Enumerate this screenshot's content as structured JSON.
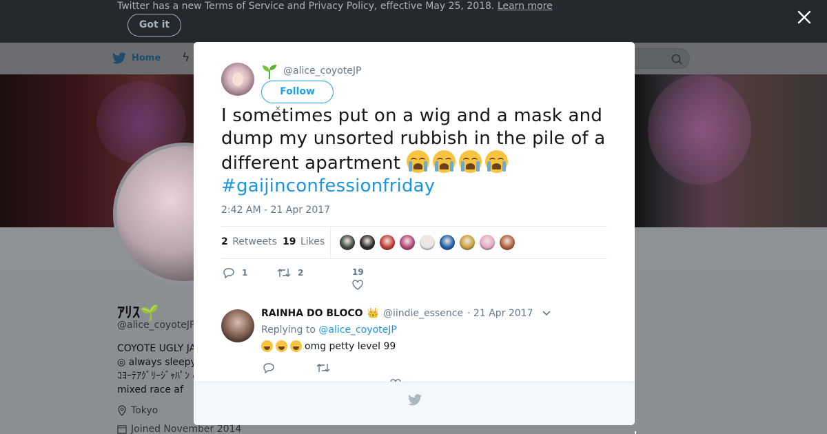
{
  "tos_banner": {
    "text": "Twitter has a new Terms of Service and Privacy Policy, effective May 25, 2018.",
    "link": "Learn more",
    "button": "Got it"
  },
  "nav": {
    "home": "Home",
    "icons": [
      "twitter-bird-icon",
      "bolt-icon",
      "search-icon"
    ]
  },
  "profile": {
    "name": "ｱﾘｽ🌱",
    "handle": "@alice_coyoteJP",
    "bio_lines": [
      "COYOTE UGLY JA",
      "◎ always sleepy",
      "ｺﾖｰﾃｱｸﾞﾘｰｼﾞｬﾊﾟﾝ ◎",
      "mixed race af"
    ],
    "location": "Tokyo",
    "joined": "Joined November 2014"
  },
  "tweet": {
    "handle": "@alice_coyoteJP",
    "follow_label": "Follow",
    "text": "I sometimes put on a wig and a mask and dump my unsorted rubbish in the pile of a different apartment",
    "emoji_count": 4,
    "hashtag": "#gaijinconfessionfriday",
    "timestamp": "2:42 AM - 21 Apr 2017",
    "retweets_count": "2",
    "retweets_label": "Retweets",
    "likes_count": "19",
    "likes_label": "Likes",
    "liker_colors": [
      "#3c4a3e",
      "#2b2b2b",
      "#c33b35",
      "#b5487a",
      "#e8e8e8",
      "#1c5fa8",
      "#c9a23c",
      "#e6a6c6",
      "#b0603d"
    ],
    "reply_count": "1",
    "retweet_action_count": "2",
    "like_action_count": "19"
  },
  "reply": {
    "name": "RAINHA DO BLOCO",
    "crown": "👑",
    "handle": "@iindie_essence",
    "date": "· 21 Apr 2017",
    "replying_prefix": "Replying to",
    "replying_to": "@alice_coyoteJP",
    "text": "omg petty level 99"
  },
  "colors": {
    "accent": "#1da1f2",
    "link": "#1b95e0",
    "muted": "#657786"
  }
}
